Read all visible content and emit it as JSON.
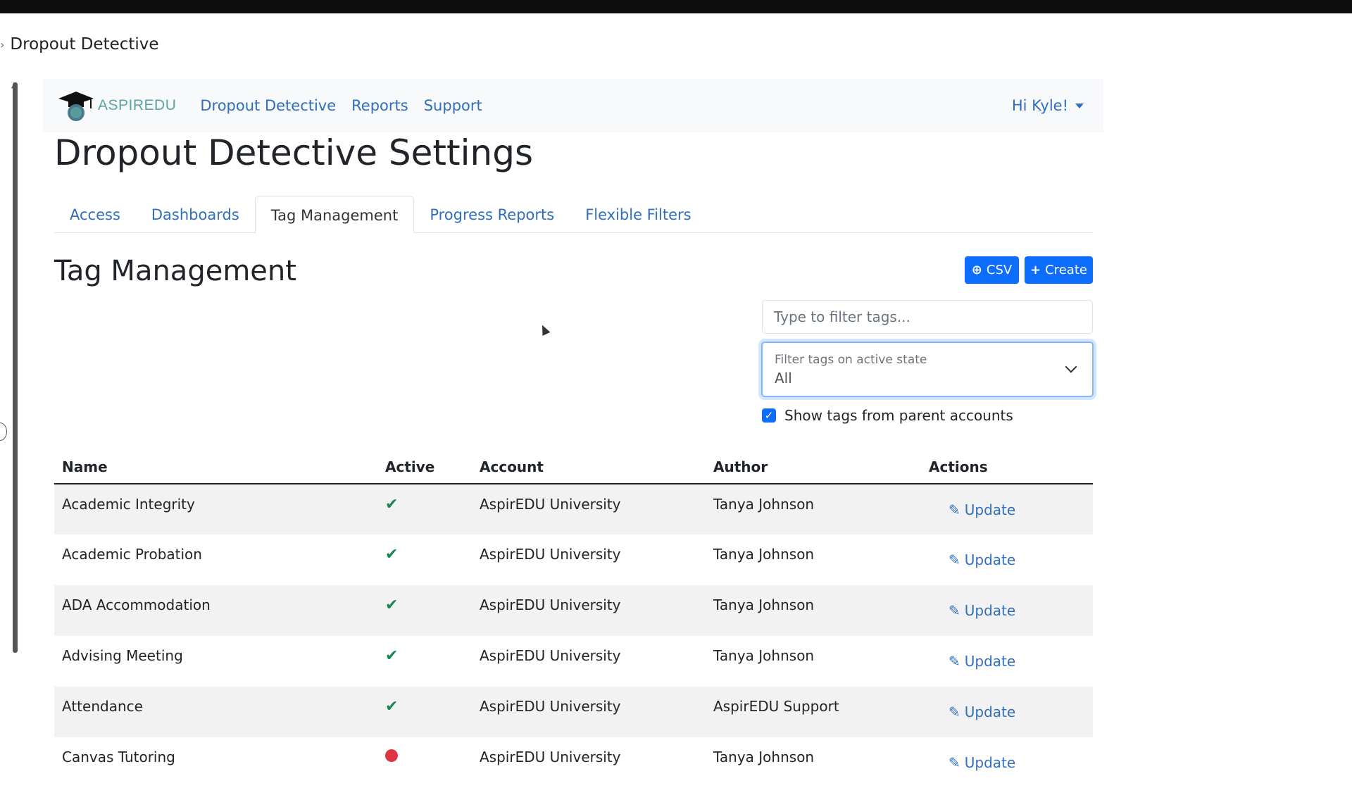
{
  "breadcrumb": {
    "title": "Dropout Detective"
  },
  "navbar": {
    "logo_text": "ASPIREDU",
    "links": [
      "Dropout Detective",
      "Reports",
      "Support"
    ],
    "user": "Hi Kyle!"
  },
  "page": {
    "title": "Dropout Detective Settings"
  },
  "tabs": [
    {
      "label": "Access",
      "active": false
    },
    {
      "label": "Dashboards",
      "active": false
    },
    {
      "label": "Tag Management",
      "active": true
    },
    {
      "label": "Progress Reports",
      "active": false
    },
    {
      "label": "Flexible Filters",
      "active": false
    }
  ],
  "section": {
    "title": "Tag Management",
    "csv_label": "CSV",
    "create_label": "Create"
  },
  "filters": {
    "search_placeholder": "Type to filter tags...",
    "select_label": "Filter tags on active state",
    "select_value": "All",
    "checkbox_label": "Show tags from parent accounts",
    "checkbox_checked": true
  },
  "table": {
    "headers": [
      "Name",
      "Active",
      "Account",
      "Author",
      "Actions"
    ],
    "rows": [
      {
        "name": "Academic Integrity",
        "active": true,
        "account": "AspirEDU University",
        "author": "Tanya Johnson",
        "action": "Update"
      },
      {
        "name": "Academic Probation",
        "active": true,
        "account": "AspirEDU University",
        "author": "Tanya Johnson",
        "action": "Update"
      },
      {
        "name": "ADA Accommodation",
        "active": true,
        "account": "AspirEDU University",
        "author": "Tanya Johnson",
        "action": "Update"
      },
      {
        "name": "Advising Meeting",
        "active": true,
        "account": "AspirEDU University",
        "author": "Tanya Johnson",
        "action": "Update"
      },
      {
        "name": "Attendance",
        "active": true,
        "account": "AspirEDU University",
        "author": "AspirEDU Support",
        "action": "Update"
      },
      {
        "name": "Canvas Tutoring",
        "active": false,
        "account": "AspirEDU University",
        "author": "Tanya Johnson",
        "action": "Update"
      }
    ]
  },
  "colors": {
    "accent": "#0d6efd",
    "link": "#2f6fbd",
    "success": "#198754",
    "danger": "#dc3545"
  }
}
